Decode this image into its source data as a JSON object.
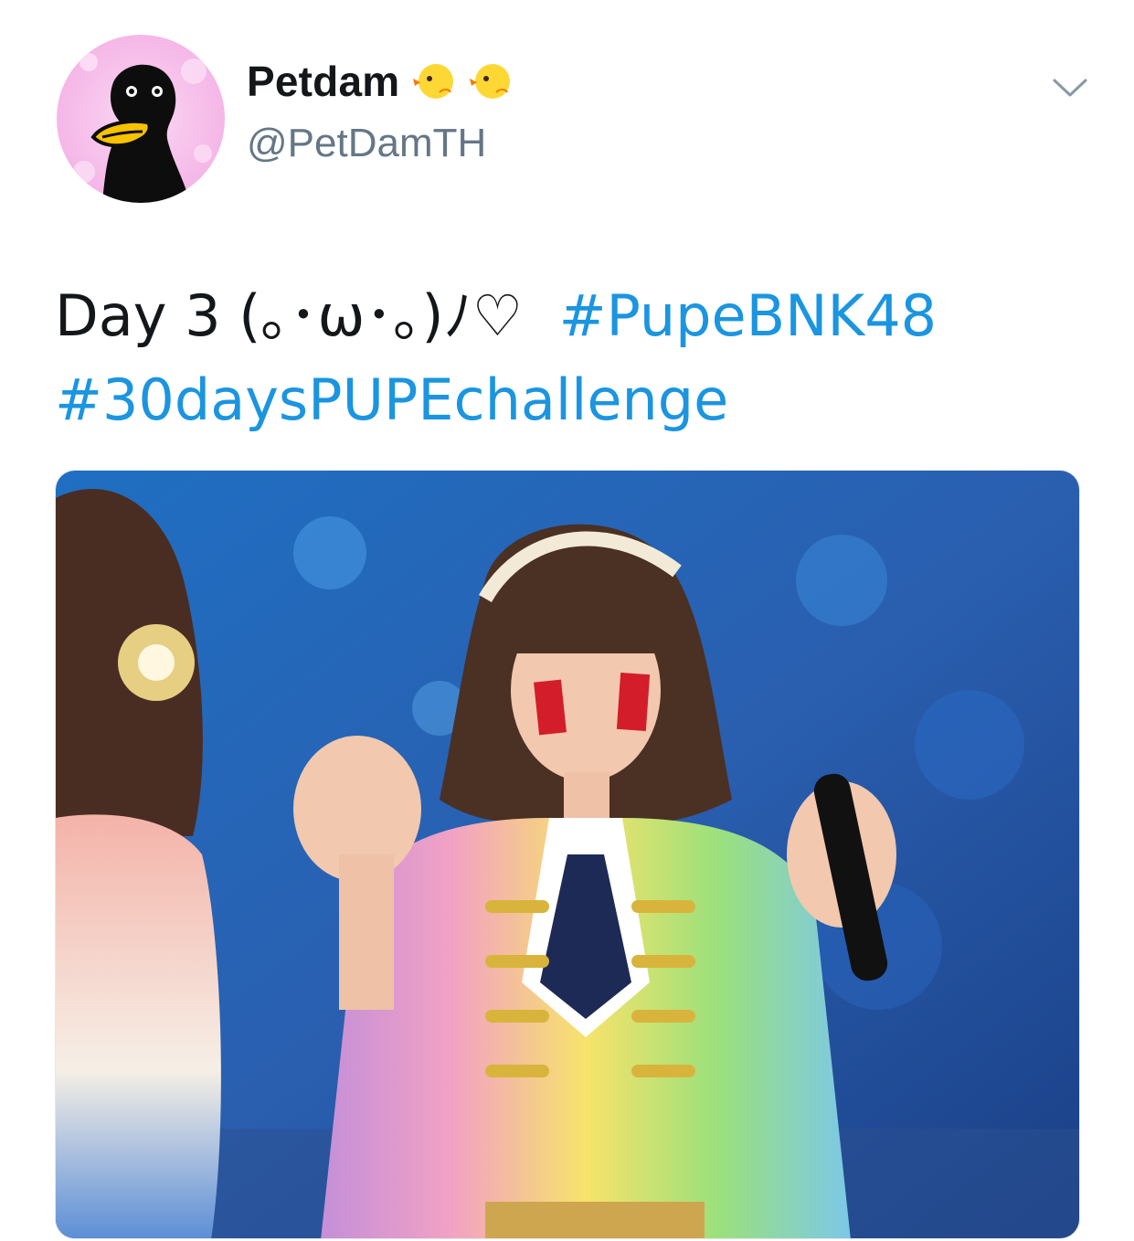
{
  "tweet": {
    "author": {
      "display_name": "Petdam",
      "name_emojis": [
        "baby-chick-icon",
        "baby-chick-icon"
      ],
      "handle": "@PetDamTH",
      "avatar_icon": "penguin-duck-avatar"
    },
    "menu_icon": "chevron-down-icon",
    "text_plain": "Day 3 (｡･ω･｡)ﾉ♡",
    "hashtags": [
      "#PupeBNK48",
      "#30daysPUPEchallenge"
    ],
    "media_icon": "photo-stage-performer"
  },
  "colors": {
    "hashtag": "#1b95e0",
    "handle": "#657786",
    "text": "#14171a",
    "avatar_bg": "#f7c6ee"
  }
}
